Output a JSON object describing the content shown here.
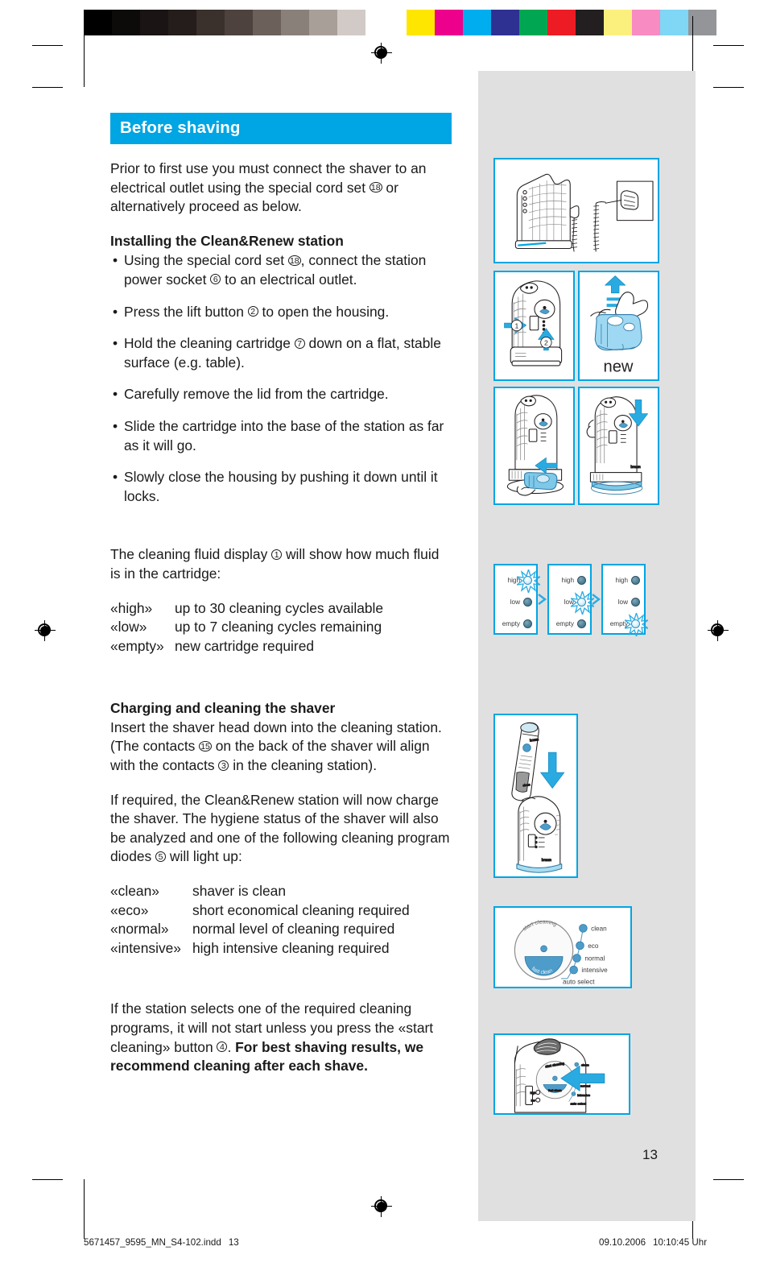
{
  "document": {
    "page_number": "13",
    "footer_left_file": "5671457_9595_MN_S4-102.indd",
    "footer_left_page": "13",
    "footer_right_date": "09.10.2006",
    "footer_right_time": "10:10:45 Uhr"
  },
  "section": {
    "banner_title": "Before shaving",
    "banner_color": "#00a5e3"
  },
  "intro": {
    "text_1": "Prior to first use you must connect the shaver to an electrical outlet using the special cord set ",
    "ref_1": "18",
    "text_2": " or alternatively proceed as below."
  },
  "installing": {
    "heading": "Installing the Clean&Renew station",
    "bullets": [
      {
        "bullet_char": "•",
        "text_1": "Using the special cord set ",
        "ref_1": "18",
        "text_2": ", connect the station power socket ",
        "ref_2": "6",
        "text_3": " to an electrical outlet."
      },
      {
        "bullet_char": "•",
        "text_1": "Press the lift button ",
        "ref_1": "2",
        "text_2": " to open the housing.",
        "ref_2": "",
        "text_3": ""
      },
      {
        "bullet_char": "•",
        "text_1": "Hold the cleaning cartridge ",
        "ref_1": "7",
        "text_2": " down on a flat, stable surface (e.g. table).",
        "ref_2": "",
        "text_3": ""
      },
      {
        "bullet_char": "•",
        "text_1": "Carefully remove the lid from the cartridge.",
        "ref_1": "",
        "text_2": "",
        "ref_2": "",
        "text_3": ""
      },
      {
        "bullet_char": "•",
        "text_1": "Slide the cartridge into the base of the station as far as it will go.",
        "ref_1": "",
        "text_2": "",
        "ref_2": "",
        "text_3": ""
      },
      {
        "bullet_char": "•",
        "text_1": "Slowly close the housing by pushing it down until it locks.",
        "ref_1": "",
        "text_2": "",
        "ref_2": "",
        "text_3": ""
      }
    ]
  },
  "fluid_display": {
    "text_1": "The cleaning fluid display ",
    "ref_1": "1",
    "text_2": " will show how much fluid is in the cartridge:",
    "levels": [
      {
        "term": "«high»",
        "desc": "up to 30 cleaning cycles available"
      },
      {
        "term": "«low»",
        "desc": "up to 7 cleaning cycles remaining"
      },
      {
        "term": "«empty»",
        "desc": "new cartridge required"
      }
    ]
  },
  "charging": {
    "heading": "Charging and cleaning the shaver",
    "p1_text_1": "Insert the shaver head down into the cleaning station. (The contacts ",
    "p1_ref_1": "15",
    "p1_text_2": " on the back of the shaver will align with the contacts ",
    "p1_ref_2": "3",
    "p1_text_3": " in the cleaning station).",
    "p2_text_1": "If required, the Clean&Renew station will now charge the shaver. The hygiene status of the shaver will also be analyzed and one of the following cleaning program diodes ",
    "p2_ref_1": "5",
    "p2_text_2": " will light up:",
    "programs": [
      {
        "term": "«clean»",
        "desc": "shaver is clean"
      },
      {
        "term": "«eco»",
        "desc": "short economical cleaning required"
      },
      {
        "term": "«normal»",
        "desc": "normal level of cleaning required"
      },
      {
        "term": "«intensive»",
        "desc": "high intensive cleaning required"
      }
    ]
  },
  "closing": {
    "text_1": "If the station selects one of the required cleaning programs, it will not start unless you press the «start cleaning» button ",
    "ref_1": "4",
    "text_2": ". ",
    "bold_text": "For best shaving results, we recommend cleaning after each shave."
  },
  "figures": {
    "fig_plug_in_outlet": "clean-renew-station-connected-to-wall-outlet",
    "fig_open_housing": "press-lift-button-to-open-housing",
    "fig_new_cartridge": "remove-lid-from-new-cartridge",
    "fig_new_label": "new",
    "fig_slide_cartridge": "slide-cartridge-into-base",
    "fig_close_housing": "close-housing-by-pushing-down",
    "fig_insert_shaver": "insert-shaver-head-down-into-station",
    "fig_press_start": "press-start-cleaning-button"
  },
  "led_panels": [
    {
      "lit": "high",
      "labels": [
        "high",
        "low",
        "empty"
      ]
    },
    {
      "lit": "low",
      "labels": [
        "high",
        "low",
        "empty"
      ]
    },
    {
      "lit": "empty",
      "labels": [
        "high",
        "low",
        "empty"
      ]
    }
  ],
  "dial": {
    "arc_label": "start cleaning",
    "segment_label": "fast clean",
    "programs": [
      "clean",
      "eco",
      "normal",
      "intensive"
    ],
    "auto_label": "auto select"
  },
  "colorbar": {
    "gray_swatches": [
      "#000000",
      "#0d0a0a",
      "#1a1514",
      "#241d1b",
      "#3a302c",
      "#4d423d",
      "#6b605a",
      "#8a807a",
      "#a99f99",
      "#d2cac6",
      "#ffffff"
    ],
    "color_swatches": [
      "#ffe600",
      "#ec008c",
      "#00aeef",
      "#2e3192",
      "#00a651",
      "#ed1c24",
      "#231f20",
      "#fbf07e",
      "#f88bc1",
      "#7fd6f5",
      "#939598"
    ]
  }
}
